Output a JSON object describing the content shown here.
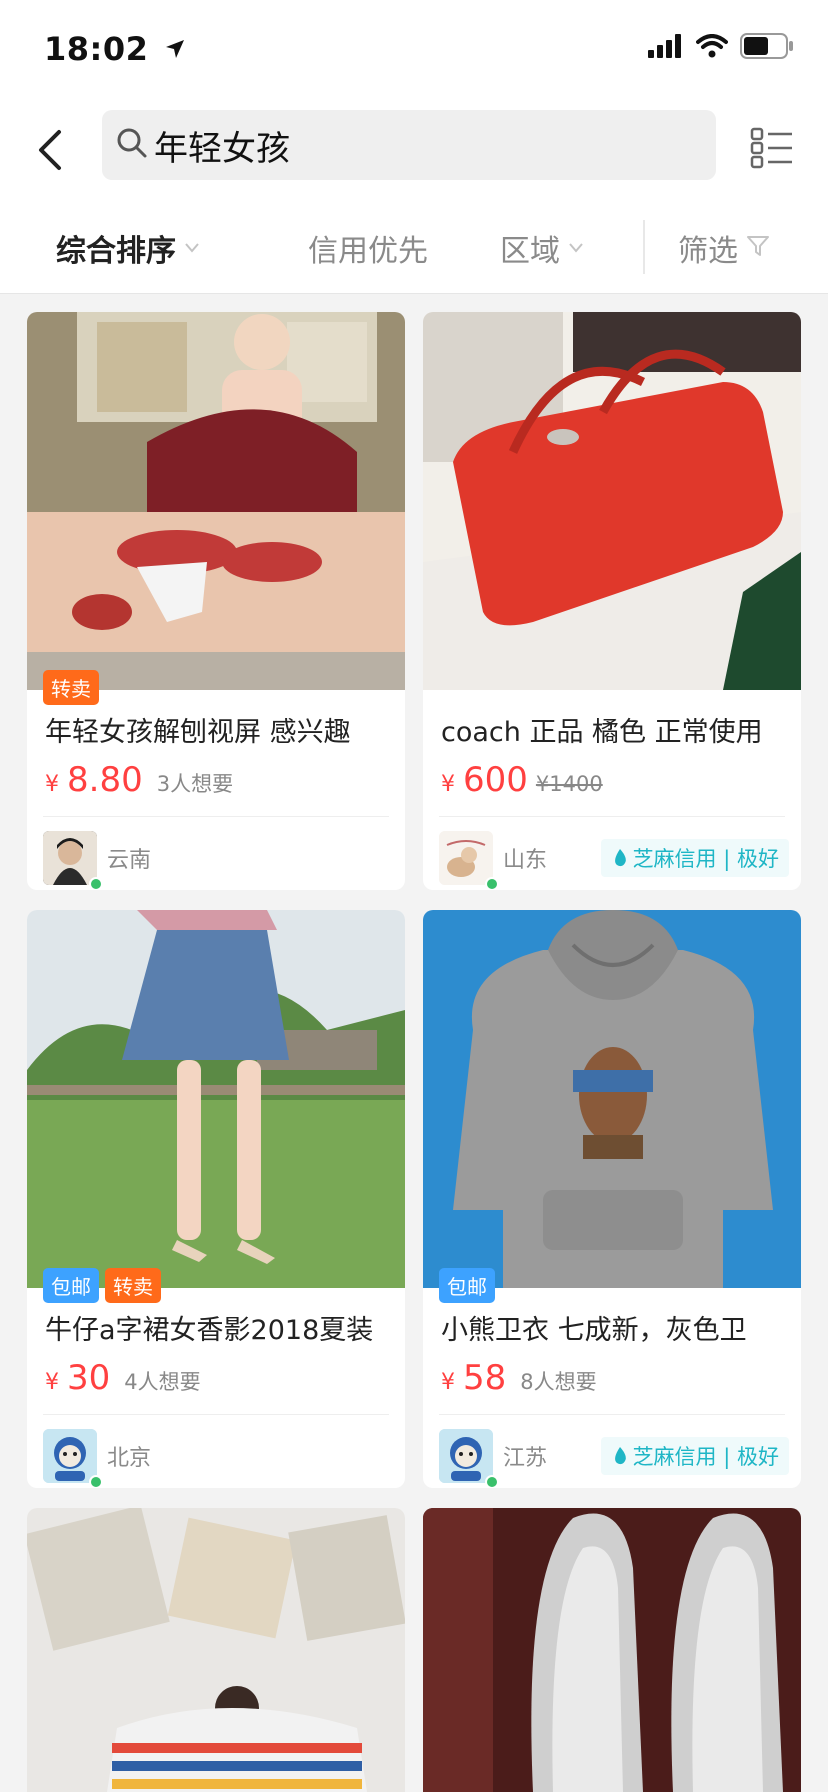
{
  "status_bar": {
    "time": "18:02",
    "battery_percent": 60
  },
  "search": {
    "query": "年轻女孩"
  },
  "filters": [
    {
      "label": "综合排序",
      "active": true,
      "chevron": true
    },
    {
      "label": "信用优先",
      "active": false,
      "chevron": false
    },
    {
      "label": "区域",
      "active": false,
      "chevron": true
    },
    {
      "label": "筛选",
      "active": false,
      "filter_icon": true
    }
  ],
  "colors": {
    "price": "#ff4040",
    "resale_badge": "#ff6a1a",
    "ship_badge": "#3da2ff",
    "credit": "#1fb6c6",
    "online": "#39c06b"
  },
  "products": [
    {
      "badges": [
        "转卖"
      ],
      "title": "年轻女孩解刨视屏 感兴趣",
      "currency": "¥",
      "price": "8.80",
      "wants": "3人想要",
      "region": "云南",
      "credit": ""
    },
    {
      "badges": [],
      "title": "coach 正品 橘色 正常使用",
      "currency": "¥",
      "price": "600",
      "original_price": "¥1400",
      "region": "山东",
      "credit": "芝麻信用 | 极好"
    },
    {
      "badges": [
        "包邮",
        "转卖"
      ],
      "title": "牛仔a字裙女香影2018夏装",
      "currency": "¥",
      "price": "30",
      "wants": "4人想要",
      "region": "北京",
      "credit": ""
    },
    {
      "badges": [
        "包邮"
      ],
      "title": "小熊卫衣 七成新，灰色卫",
      "currency": "¥",
      "price": "58",
      "wants": "8人想要",
      "region": "江苏",
      "credit": "芝麻信用 | 极好"
    }
  ]
}
